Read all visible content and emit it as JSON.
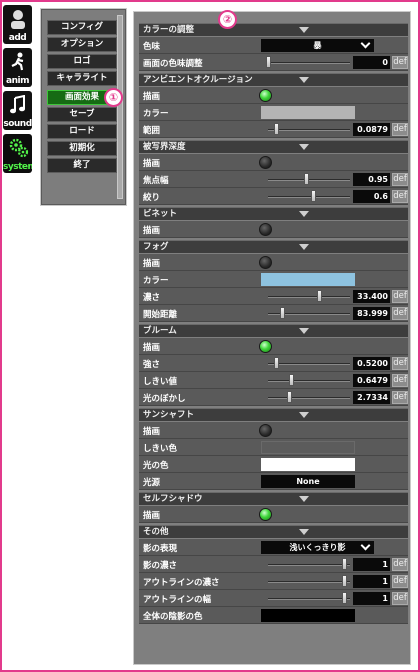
{
  "sidebar": {
    "icons": [
      {
        "name": "add",
        "label": "add"
      },
      {
        "name": "anim",
        "label": "anim"
      },
      {
        "name": "sound",
        "label": "sound"
      },
      {
        "name": "system",
        "label": "system"
      }
    ]
  },
  "menu": {
    "items": [
      "コンフィグ",
      "オプション",
      "ロゴ",
      "キャラライト",
      "画面効果",
      "セーブ",
      "ロード",
      "初期化",
      "終了"
    ],
    "selected": "画面効果"
  },
  "badges": {
    "b1": "①",
    "b2": "②"
  },
  "sections": {
    "color_adjust": "カラーの調整",
    "ao": "アンビエントオクルージョン",
    "dof": "被写界深度",
    "vignette": "ビネット",
    "fog": "フォグ",
    "bloom": "ブルーム",
    "sunshaft": "サンシャフト",
    "selfshadow": "セルフシャドウ",
    "other": "その他"
  },
  "rows": {
    "tint": {
      "label": "色味",
      "value": "暴"
    },
    "screen_tint": {
      "label": "画面の色味調整",
      "value": "0"
    },
    "ao_draw": {
      "label": "描画",
      "on": true
    },
    "ao_color": {
      "label": "カラー",
      "color": "#b4b4b4"
    },
    "ao_range": {
      "label": "範囲",
      "value": "0.0879"
    },
    "dof_draw": {
      "label": "描画",
      "on": false
    },
    "dof_focus": {
      "label": "焦点幅",
      "value": "0.95"
    },
    "dof_aperture": {
      "label": "絞り",
      "value": "0.6"
    },
    "vig_draw": {
      "label": "描画",
      "on": false
    },
    "fog_draw": {
      "label": "描画",
      "on": false
    },
    "fog_color": {
      "label": "カラー",
      "color": "#8ec3e0"
    },
    "fog_density": {
      "label": "濃さ",
      "value": "33.400"
    },
    "fog_start": {
      "label": "開始距離",
      "value": "83.999"
    },
    "bloom_draw": {
      "label": "描画",
      "on": true
    },
    "bloom_strength": {
      "label": "強さ",
      "value": "0.5200"
    },
    "bloom_threshold": {
      "label": "しきい値",
      "value": "0.6479"
    },
    "bloom_blur": {
      "label": "光のぼかし",
      "value": "2.7334"
    },
    "ss_draw": {
      "label": "描画",
      "on": false
    },
    "ss_threshold_color": {
      "label": "しきい色",
      "color": "#5c5c5c"
    },
    "ss_light_color": {
      "label": "光の色",
      "color": "#ffffff"
    },
    "ss_source": {
      "label": "光源",
      "value": "None"
    },
    "shadow_draw": {
      "label": "描画",
      "on": true
    },
    "other_shadow": {
      "label": "影の表現",
      "value": "浅いくっきり影"
    },
    "other_shadow_depth": {
      "label": "影の濃さ",
      "value": "1"
    },
    "other_outline_depth": {
      "label": "アウトラインの濃さ",
      "value": "1"
    },
    "other_outline_width": {
      "label": "アウトラインの幅",
      "value": "1"
    },
    "other_global_shadow": {
      "label": "全体の陰影の色",
      "color": "#000000"
    }
  },
  "def_label": "def"
}
